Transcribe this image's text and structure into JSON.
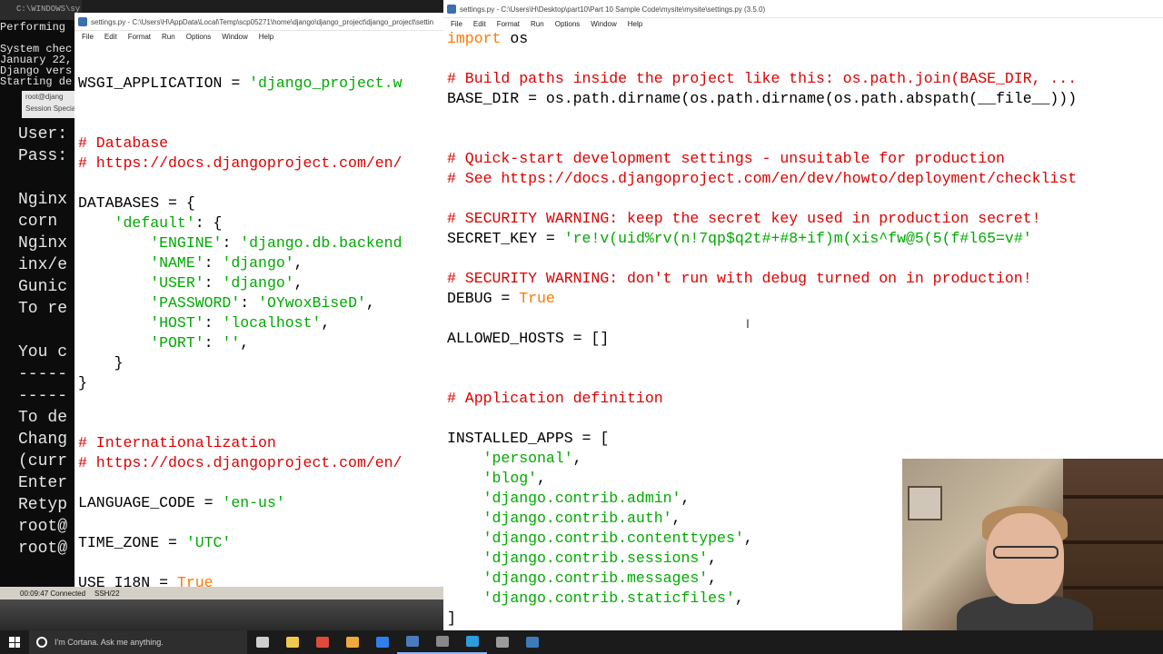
{
  "bg_terminal": {
    "title": "C:\\WINDOWS\\sy",
    "cmd_lines": [
      "Performing",
      "",
      "System chec",
      "January 22,",
      "Django vers",
      "Starting de"
    ],
    "ssh_lines": [
      "User:",
      "Pass:",
      "",
      "Nginx",
      "corn",
      "Nginx",
      "inx/e",
      "Gunic",
      "To re",
      "",
      "You c",
      "-----",
      "-----",
      "To de",
      "Chang",
      "(curr",
      "Enter",
      "Retyp",
      "root@",
      "root@"
    ]
  },
  "putty_strip": {
    "title": "root@djang",
    "session": "Session",
    "special": "Specia"
  },
  "putty_status": {
    "time": "00:09:47 Connected",
    "ssh": "SSH/22"
  },
  "left_idle": {
    "title": "settings.py - C:\\Users\\H\\AppData\\Local\\Temp\\scp05271\\home\\django\\django_project\\django_project\\settin",
    "menu": [
      "File",
      "Edit",
      "Format",
      "Run",
      "Options",
      "Window",
      "Help"
    ],
    "lines": [
      [
        [
          "WSGI_APPLICATION = ",
          ""
        ],
        [
          "'django_project.w",
          "st"
        ]
      ],
      [
        [
          "",
          ""
        ]
      ],
      [
        [
          "",
          ""
        ]
      ],
      [
        [
          "# Database",
          "cm"
        ]
      ],
      [
        [
          "# https://docs.djangoproject.com/en/",
          "cm"
        ]
      ],
      [
        [
          "",
          ""
        ]
      ],
      [
        [
          "DATABASES = {",
          ""
        ]
      ],
      [
        [
          "    ",
          ""
        ],
        [
          "'default'",
          "st"
        ],
        [
          ": {",
          ""
        ]
      ],
      [
        [
          "        ",
          ""
        ],
        [
          "'ENGINE'",
          "st"
        ],
        [
          ": ",
          ""
        ],
        [
          "'django.db.backend",
          "st"
        ]
      ],
      [
        [
          "        ",
          ""
        ],
        [
          "'NAME'",
          "st"
        ],
        [
          ": ",
          ""
        ],
        [
          "'django'",
          "st"
        ],
        [
          ",",
          ""
        ]
      ],
      [
        [
          "        ",
          ""
        ],
        [
          "'USER'",
          "st"
        ],
        [
          ": ",
          ""
        ],
        [
          "'django'",
          "st"
        ],
        [
          ",",
          ""
        ]
      ],
      [
        [
          "        ",
          ""
        ],
        [
          "'PASSWORD'",
          "st"
        ],
        [
          ": ",
          ""
        ],
        [
          "'OYwoxBiseD'",
          "st"
        ],
        [
          ",",
          ""
        ]
      ],
      [
        [
          "        ",
          ""
        ],
        [
          "'HOST'",
          "st"
        ],
        [
          ": ",
          ""
        ],
        [
          "'localhost'",
          "st"
        ],
        [
          ",",
          ""
        ]
      ],
      [
        [
          "        ",
          ""
        ],
        [
          "'PORT'",
          "st"
        ],
        [
          ": ",
          ""
        ],
        [
          "''",
          "st"
        ],
        [
          ",",
          ""
        ]
      ],
      [
        [
          "    }",
          ""
        ]
      ],
      [
        [
          "}",
          ""
        ]
      ],
      [
        [
          "",
          ""
        ]
      ],
      [
        [
          "",
          ""
        ]
      ],
      [
        [
          "# Internationalization",
          "cm"
        ]
      ],
      [
        [
          "# https://docs.djangoproject.com/en/",
          "cm"
        ]
      ],
      [
        [
          "",
          ""
        ]
      ],
      [
        [
          "LANGUAGE_CODE = ",
          ""
        ],
        [
          "'en-us'",
          "st"
        ]
      ],
      [
        [
          "",
          ""
        ]
      ],
      [
        [
          "TIME_ZONE = ",
          ""
        ],
        [
          "'UTC'",
          "st"
        ]
      ],
      [
        [
          "",
          ""
        ]
      ],
      [
        [
          "USE_I18N = ",
          ""
        ],
        [
          "True",
          "kw"
        ]
      ]
    ]
  },
  "right_idle": {
    "title": "settings.py - C:\\Users\\H\\Desktop\\part10\\Part 10 Sample Code\\mysite\\mysite\\settings.py (3.5.0)",
    "menu": [
      "File",
      "Edit",
      "Format",
      "Run",
      "Options",
      "Window",
      "Help"
    ],
    "lines": [
      [
        [
          "import",
          "kw"
        ],
        [
          " os",
          ""
        ]
      ],
      [
        [
          "",
          ""
        ]
      ],
      [
        [
          "# Build paths inside the project like this: os.path.join(BASE_DIR, ...",
          "cm"
        ]
      ],
      [
        [
          "BASE_DIR = os.path.dirname(os.path.dirname(os.path.abspath(__file__)))",
          ""
        ]
      ],
      [
        [
          "",
          ""
        ]
      ],
      [
        [
          "",
          ""
        ]
      ],
      [
        [
          "# Quick-start development settings - unsuitable for production",
          "cm"
        ]
      ],
      [
        [
          "# See https://docs.djangoproject.com/en/dev/howto/deployment/checklist",
          "cm"
        ]
      ],
      [
        [
          "",
          ""
        ]
      ],
      [
        [
          "# SECURITY WARNING: keep the secret key used in production secret!",
          "cm"
        ]
      ],
      [
        [
          "SECRET_KEY = ",
          ""
        ],
        [
          "'re!v(uid%rv(n!7qp$q2t#+#8+if)m(xis^fw@5(5(f#l65=v#'",
          "st"
        ]
      ],
      [
        [
          "",
          ""
        ]
      ],
      [
        [
          "# SECURITY WARNING: don't run with debug turned on in production!",
          "cm"
        ]
      ],
      [
        [
          "DEBUG = ",
          ""
        ],
        [
          "True",
          "kw"
        ]
      ],
      [
        [
          "",
          ""
        ]
      ],
      [
        [
          "ALLOWED_HOSTS = []",
          ""
        ]
      ],
      [
        [
          "",
          ""
        ]
      ],
      [
        [
          "",
          ""
        ]
      ],
      [
        [
          "# Application definition",
          "cm"
        ]
      ],
      [
        [
          "",
          ""
        ]
      ],
      [
        [
          "INSTALLED_APPS = [",
          ""
        ]
      ],
      [
        [
          "    ",
          ""
        ],
        [
          "'personal'",
          "st"
        ],
        [
          ",",
          ""
        ]
      ],
      [
        [
          "    ",
          ""
        ],
        [
          "'blog'",
          "st"
        ],
        [
          ",",
          ""
        ]
      ],
      [
        [
          "    ",
          ""
        ],
        [
          "'django.contrib.admin'",
          "st"
        ],
        [
          ",",
          ""
        ]
      ],
      [
        [
          "    ",
          ""
        ],
        [
          "'django.contrib.auth'",
          "st"
        ],
        [
          ",",
          ""
        ]
      ],
      [
        [
          "    ",
          ""
        ],
        [
          "'django.contrib.contenttypes'",
          "st"
        ],
        [
          ",",
          ""
        ]
      ],
      [
        [
          "    ",
          ""
        ],
        [
          "'django.contrib.sessions'",
          "st"
        ],
        [
          ",",
          ""
        ]
      ],
      [
        [
          "    ",
          ""
        ],
        [
          "'django.contrib.messages'",
          "st"
        ],
        [
          ",",
          ""
        ]
      ],
      [
        [
          "    ",
          ""
        ],
        [
          "'django.contrib.staticfiles'",
          "st"
        ],
        [
          ",",
          ""
        ]
      ],
      [
        [
          "]",
          ""
        ]
      ]
    ]
  },
  "taskbar": {
    "cortana_placeholder": "I'm Cortana. Ask me anything.",
    "icons": [
      {
        "name": "task-view-icon",
        "color": "#cfcfcf"
      },
      {
        "name": "file-explorer-icon",
        "color": "#f2c94c"
      },
      {
        "name": "chrome-icon",
        "color": "#e04a3c"
      },
      {
        "name": "media-player-icon",
        "color": "#f2a93b"
      },
      {
        "name": "browser-icon",
        "color": "#2f80ed"
      },
      {
        "name": "idle-icon",
        "color": "#4a7bbf"
      },
      {
        "name": "terminal-icon",
        "color": "#888888"
      },
      {
        "name": "putty-icon",
        "color": "#2d9cdb"
      },
      {
        "name": "network-icon",
        "color": "#9b9b9b"
      },
      {
        "name": "python-icon",
        "color": "#3e7ab8"
      }
    ]
  }
}
